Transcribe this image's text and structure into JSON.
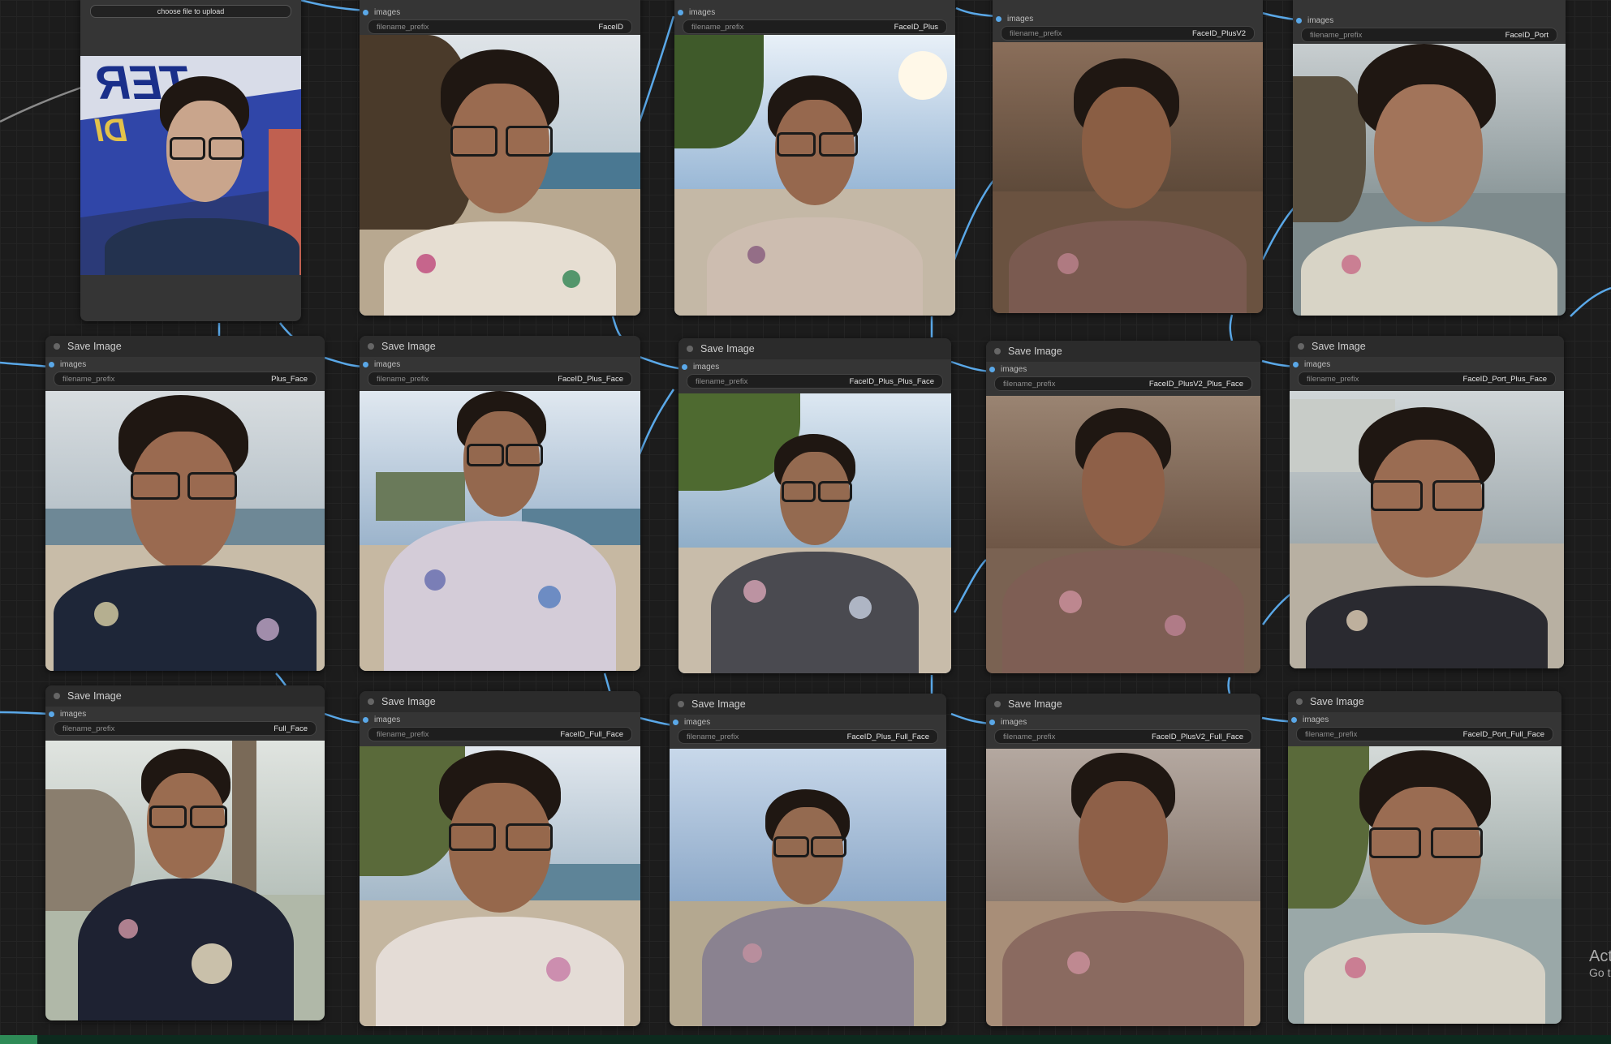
{
  "node_title": "Save Image",
  "slot_label": "images",
  "widget_label": "filename_prefix",
  "load_node": {
    "upload_label": "choose file to upload",
    "poster_text_1": "TER",
    "poster_text_2": "DI"
  },
  "top_row_prefixes": [
    "FaceID",
    "FaceID_Plus",
    "FaceID_PlusV2",
    "FaceID_Port"
  ],
  "nodes": [
    {
      "title": "Save Image",
      "prefix": "Plus_Face"
    },
    {
      "title": "Save Image",
      "prefix": "FaceID_Plus_Face"
    },
    {
      "title": "Save Image",
      "prefix": "FaceID_Plus_Plus_Face"
    },
    {
      "title": "Save Image",
      "prefix": "FaceID_PlusV2_Plus_Face"
    },
    {
      "title": "Save Image",
      "prefix": "FaceID_Port_Plus_Face"
    },
    {
      "title": "Save Image",
      "prefix": "Full_Face"
    },
    {
      "title": "Save Image",
      "prefix": "FaceID_Full_Face"
    },
    {
      "title": "Save Image",
      "prefix": "FaceID_Plus_Full_Face"
    },
    {
      "title": "Save Image",
      "prefix": "FaceID_PlusV2_Full_Face"
    },
    {
      "title": "Save Image",
      "prefix": "FaceID_Port_Full_Face"
    }
  ],
  "watermark": {
    "line1": "Act",
    "line2": "Go t"
  },
  "colors": {
    "link": "#5aa8e8",
    "node_bg": "#353535",
    "canvas_bg": "#1c1c1c"
  }
}
